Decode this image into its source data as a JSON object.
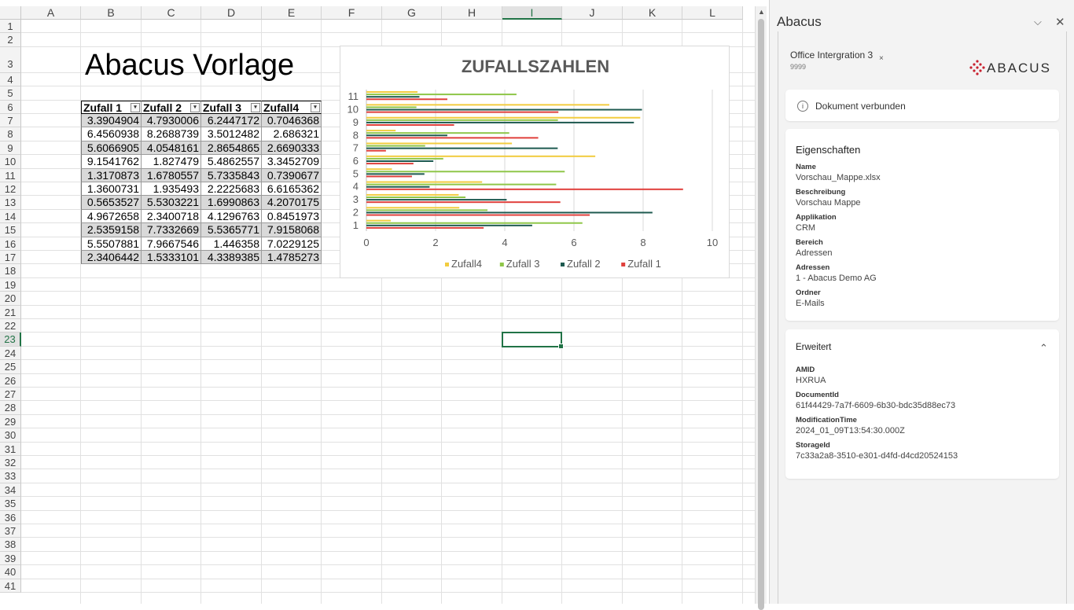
{
  "sheet": {
    "columns": [
      "A",
      "B",
      "C",
      "D",
      "E",
      "F",
      "G",
      "H",
      "I",
      "J",
      "K",
      "L"
    ],
    "rows": [
      "1",
      "2",
      "3",
      "4",
      "5",
      "6",
      "7",
      "8",
      "9",
      "10",
      "11",
      "12",
      "13",
      "14",
      "15",
      "16",
      "17",
      "18",
      "19",
      "20",
      "21",
      "22",
      "23",
      "24",
      "25",
      "26",
      "27",
      "28",
      "29",
      "30",
      "31",
      "32",
      "33",
      "34",
      "35",
      "36",
      "37",
      "38",
      "39",
      "40",
      "41"
    ],
    "selected_column": "I",
    "selected_row": "23",
    "title": "Abacus Vorlage",
    "table": {
      "headers": [
        "Zufall 1",
        "Zufall 2",
        "Zufall 3",
        "Zufall4"
      ],
      "filter_glyph": "▾",
      "rows": [
        [
          "3.3904904",
          "4.7930006",
          "6.2447172",
          "0.7046368"
        ],
        [
          "6.4560938",
          "8.2688739",
          "3.5012482",
          "2.686321"
        ],
        [
          "5.6066905",
          "4.0548161",
          "2.8654865",
          "2.6690333"
        ],
        [
          "9.1541762",
          "1.827479",
          "5.4862557",
          "3.3452709"
        ],
        [
          "1.3170873",
          "1.6780557",
          "5.7335843",
          "0.7390677"
        ],
        [
          "1.3600731",
          "1.935493",
          "2.2225683",
          "6.6165362"
        ],
        [
          "0.5653527",
          "5.5303221",
          "1.6990863",
          "4.2070175"
        ],
        [
          "4.9672658",
          "2.3400718",
          "4.1296763",
          "0.8451973"
        ],
        [
          "2.5359158",
          "7.7332669",
          "5.5365771",
          "7.9158068"
        ],
        [
          "5.5507881",
          "7.9667546",
          "1.446358",
          "7.0229125"
        ],
        [
          "2.3406442",
          "1.5333101",
          "4.3389385",
          "1.4785273"
        ]
      ]
    }
  },
  "chart_data": {
    "type": "bar",
    "orientation": "horizontal",
    "title": "ZUFALLSZAHLEN",
    "categories": [
      "1",
      "2",
      "3",
      "4",
      "5",
      "6",
      "7",
      "8",
      "9",
      "10",
      "11"
    ],
    "xlim": [
      0,
      10
    ],
    "xticks": [
      "0",
      "2",
      "4",
      "6",
      "8",
      "10"
    ],
    "grid": true,
    "legend_position": "bottom",
    "series": [
      {
        "name": "Zufall 1",
        "color": "#e0403c",
        "values": [
          3.3904904,
          6.4560938,
          5.6066905,
          9.1541762,
          1.3170873,
          1.3600731,
          0.5653527,
          4.9672658,
          2.5359158,
          5.5507881,
          2.3406442
        ]
      },
      {
        "name": "Zufall 2",
        "color": "#1e5a50",
        "values": [
          4.7930006,
          8.2688739,
          4.0548161,
          1.827479,
          1.6780557,
          1.935493,
          5.5303221,
          2.3400718,
          7.7332669,
          7.9667546,
          1.5333101
        ]
      },
      {
        "name": "Zufall 3",
        "color": "#8fc649",
        "values": [
          6.2447172,
          3.5012482,
          2.8654865,
          5.4862557,
          5.7335843,
          2.2225683,
          1.6990863,
          4.1296763,
          5.5365771,
          1.446358,
          4.3389385
        ]
      },
      {
        "name": "Zufall4",
        "color": "#f2cc3f",
        "values": [
          0.7046368,
          2.686321,
          2.6690333,
          3.3452709,
          0.7390677,
          6.6165362,
          4.2070175,
          0.8451973,
          7.9158068,
          7.0229125,
          1.4785273
        ]
      }
    ],
    "legend_order": [
      "Zufall4",
      "Zufall 3",
      "Zufall 2",
      "Zufall 1"
    ]
  },
  "pane": {
    "title": "Abacus",
    "chevron_icon": "chevron-down-icon",
    "close_icon": "close-icon",
    "doc": {
      "name": "Office Intergration 3",
      "close_glyph": "×",
      "number": "9999"
    },
    "logo_text": "ABACUS",
    "status": {
      "icon_glyph": "i",
      "text": "Dokument verbunden"
    },
    "properties": {
      "title": "Eigenschaften",
      "items": [
        {
          "label": "Name",
          "value": "Vorschau_Mappe.xlsx"
        },
        {
          "label": "Beschreibung",
          "value": "Vorschau Mappe"
        },
        {
          "label": "Applikation",
          "value": "CRM"
        },
        {
          "label": "Bereich",
          "value": "Adressen"
        },
        {
          "label": "Adressen",
          "value": "1 - Abacus Demo AG"
        },
        {
          "label": "Ordner",
          "value": "E-Mails"
        }
      ]
    },
    "extended": {
      "title": "Erweitert",
      "items": [
        {
          "label": "AMID",
          "value": "HXRUA"
        },
        {
          "label": "DocumentId",
          "value": "61f44429-7a7f-6609-6b30-bdc35d88ec73"
        },
        {
          "label": "ModificationTime",
          "value": "2024_01_09T13:54:30.000Z"
        },
        {
          "label": "StorageId",
          "value": "7c33a2a8-3510-e301-d4fd-d4cd20524153"
        }
      ]
    }
  }
}
